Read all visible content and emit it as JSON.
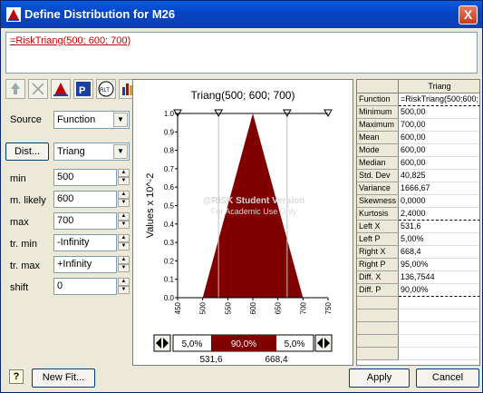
{
  "window": {
    "title": "Define Distribution for M26",
    "close_glyph": "X"
  },
  "formula": {
    "text": "=RiskTriang(500; 600; 700)"
  },
  "toolbar": {
    "icons": [
      "reset-icon",
      "cut-icon",
      "triangle-dist-icon",
      "p0-icon",
      "rlt-icon",
      "bar-chart-icon"
    ]
  },
  "left": {
    "source_label": "Source",
    "source_value": "Function",
    "dist_button": "Dist...",
    "dist_value": "Triang",
    "params": [
      {
        "label": "min",
        "value": "500"
      },
      {
        "label": "m. likely",
        "value": "600"
      },
      {
        "label": "max",
        "value": "700"
      },
      {
        "label": "tr. min",
        "value": "-Infinity"
      },
      {
        "label": "tr. max",
        "value": "+Infinity"
      },
      {
        "label": "shift",
        "value": "0"
      }
    ]
  },
  "chart_data": {
    "type": "area",
    "title": "Triang(500; 600; 700)",
    "ylabel": "Values x 10^-2",
    "xlabel": "",
    "x": [
      500,
      600,
      700
    ],
    "y": [
      0,
      1.0,
      0
    ],
    "xlim": [
      450,
      750
    ],
    "ylim": [
      0,
      1.0
    ],
    "xticks": [
      "450",
      "500",
      "550",
      "600",
      "650",
      "700",
      "750"
    ],
    "yticks": [
      "0.0",
      "0.1",
      "0.2",
      "0.3",
      "0.4",
      "0.5",
      "0.6",
      "0.7",
      "0.8",
      "0.9",
      "1.0"
    ],
    "delimiters": [
      531.6,
      668.4
    ],
    "fill_color": "#800000",
    "watermark_line1": "@RISK Student Version",
    "watermark_line2": "For Academic Use Only",
    "probs": [
      "5,0%",
      "90,0%",
      "5,0%"
    ],
    "delimiter_labels": [
      "531,6",
      "668,4"
    ]
  },
  "stats": {
    "header": "Triang",
    "rows": [
      {
        "label": "Function",
        "value": "=RiskTriang(500;600;"
      },
      {
        "label": "Minimum",
        "value": "500,00"
      },
      {
        "label": "Maximum",
        "value": "700,00"
      },
      {
        "label": "Mean",
        "value": "600,00"
      },
      {
        "label": "Mode",
        "value": "600,00"
      },
      {
        "label": "Median",
        "value": "600,00"
      },
      {
        "label": "Std. Dev",
        "value": "40,825"
      },
      {
        "label": "Variance",
        "value": "1666,67"
      },
      {
        "label": "Skewness",
        "value": "0,0000"
      },
      {
        "label": "Kurtosis",
        "value": "2,4000"
      },
      {
        "label": "Left X",
        "value": "531,6"
      },
      {
        "label": "Left P",
        "value": "5,00%"
      },
      {
        "label": "Right X",
        "value": "668,4"
      },
      {
        "label": "Right P",
        "value": "95,00%"
      },
      {
        "label": "Diff. X",
        "value": "136,7544"
      },
      {
        "label": "Diff. P",
        "value": "90,00%"
      }
    ]
  },
  "bottom": {
    "help_glyph": "?",
    "new_fit": "New Fit...",
    "apply": "Apply",
    "cancel": "Cancel"
  }
}
